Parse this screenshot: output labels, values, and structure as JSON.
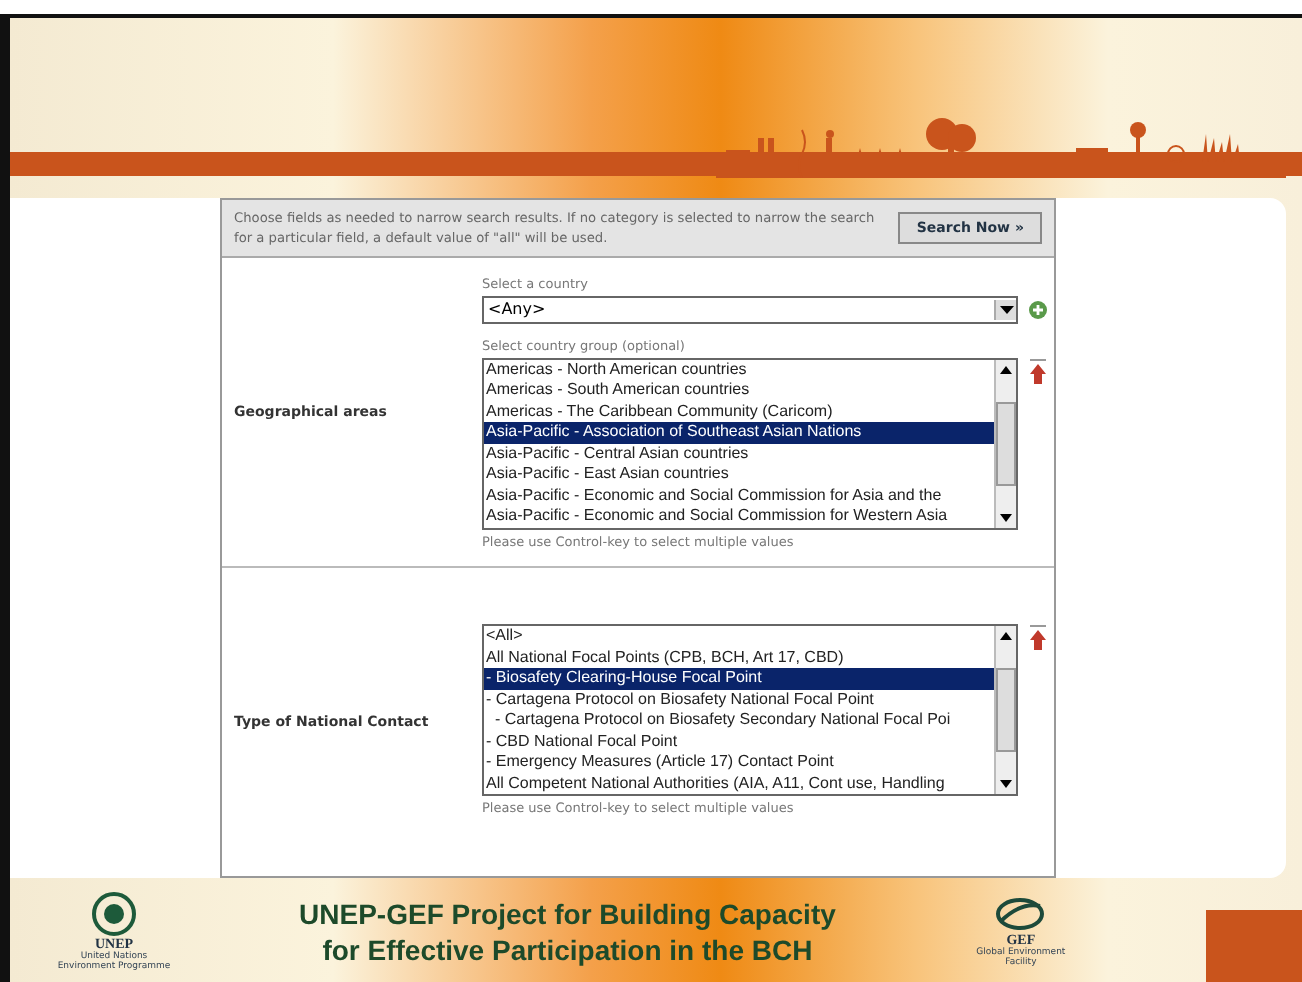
{
  "form": {
    "intro": "Choose fields as needed to narrow search results. If no category is selected to narrow the search for a particular field, a default value of \"all\" will be used.",
    "search_button": "Search Now »",
    "sections": [
      {
        "label": "Geographical areas",
        "fields": [
          {
            "kind": "dropdown",
            "label": "Select a country",
            "value": "<Any>"
          },
          {
            "kind": "listbox",
            "label": "Select country group (optional)",
            "help": "Please use Control-key to select multiple values",
            "items": [
              {
                "text": "Americas - North American countries",
                "selected": false
              },
              {
                "text": "Americas - South American countries",
                "selected": false
              },
              {
                "text": "Americas - The Caribbean Community (Caricom)",
                "selected": false
              },
              {
                "text": "Asia-Pacific - Association of Southeast Asian Nations",
                "selected": true
              },
              {
                "text": "Asia-Pacific - Central Asian countries",
                "selected": false
              },
              {
                "text": "Asia-Pacific - East Asian countries",
                "selected": false
              },
              {
                "text": "Asia-Pacific - Economic and Social Commission for Asia and the",
                "selected": false
              },
              {
                "text": "Asia-Pacific - Economic and Social Commission for Western Asia",
                "selected": false
              }
            ]
          }
        ]
      },
      {
        "label": "Type of National Contact",
        "fields": [
          {
            "kind": "listbox",
            "help": "Please use Control-key to select multiple values",
            "items": [
              {
                "text": "<All>",
                "selected": false
              },
              {
                "text": "All National Focal Points (CPB, BCH, Art 17, CBD)",
                "selected": false
              },
              {
                "text": "- Biosafety Clearing-House Focal Point",
                "selected": true
              },
              {
                "text": "- Cartagena Protocol on Biosafety National Focal Point",
                "selected": false
              },
              {
                "text": "  - Cartagena Protocol on Biosafety Secondary National Focal Poi",
                "selected": false
              },
              {
                "text": "- CBD National Focal Point",
                "selected": false
              },
              {
                "text": "- Emergency Measures (Article 17) Contact Point",
                "selected": false
              },
              {
                "text": "All Competent National Authorities (AIA, A11, Cont use, Handling",
                "selected": false
              }
            ]
          }
        ]
      }
    ]
  },
  "footer": {
    "title_lines": [
      "UNEP-GEF Project for Building Capacity",
      "for Effective Participation in the BCH"
    ],
    "left_logo": {
      "name": "UNEP",
      "caption": "United Nations Environment Programme"
    },
    "right_logo": {
      "name": "GEF",
      "caption": "Global Environment Facility"
    }
  }
}
